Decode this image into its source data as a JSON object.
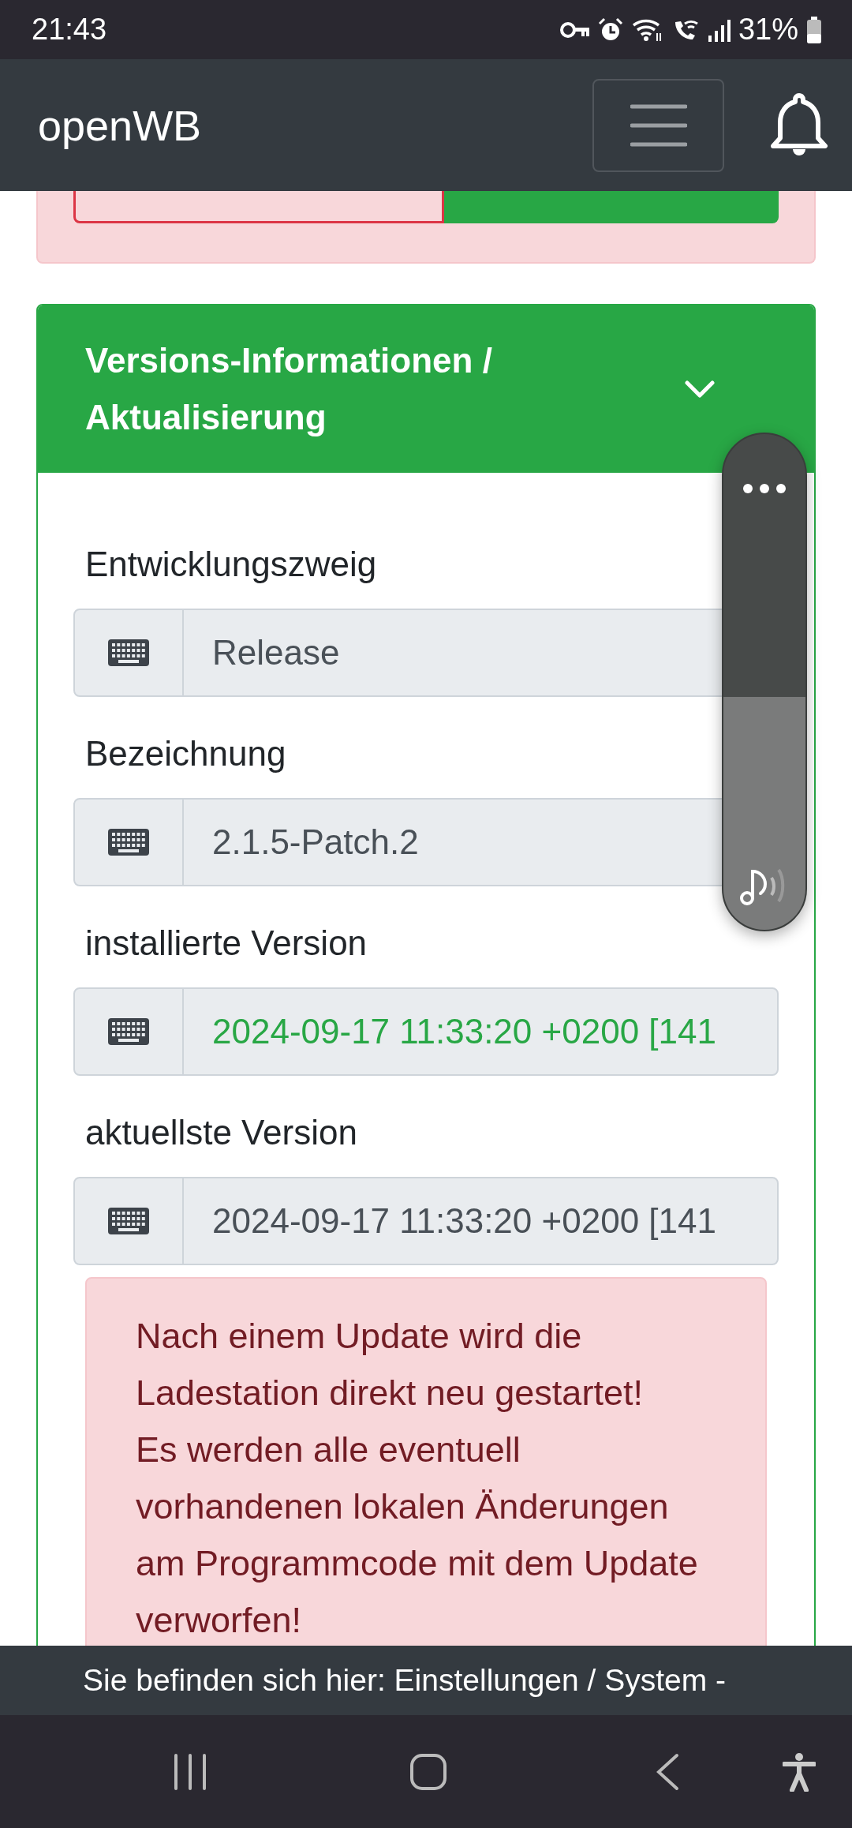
{
  "status_bar": {
    "time": "21:43",
    "battery": "31%"
  },
  "navbar": {
    "brand": "openWB"
  },
  "card": {
    "title": "Versions-Informationen / Aktualisierung",
    "expanded": true,
    "fields": [
      {
        "label": "Entwicklungszweig",
        "value": "Release",
        "highlight": false
      },
      {
        "label": "Bezeichnung",
        "value": "2.1.5-Patch.2",
        "highlight": false
      },
      {
        "label": "installierte Version",
        "value": "2024-09-17 11:33:20 +0200 [141",
        "highlight": true
      },
      {
        "label": "aktuellste Version",
        "value": "2024-09-17 11:33:20 +0200 [141",
        "highlight": false
      }
    ],
    "alert": [
      "Nach einem Update wird die Ladestation direkt neu gestartet!",
      "Es werden alle eventuell vorhandenen lokalen Änderungen am Programmcode mit dem Update verworfen!"
    ]
  },
  "volume": {
    "level": 0.47
  },
  "breadcrumb": "Sie befinden sich hier: Einstellungen / System -"
}
